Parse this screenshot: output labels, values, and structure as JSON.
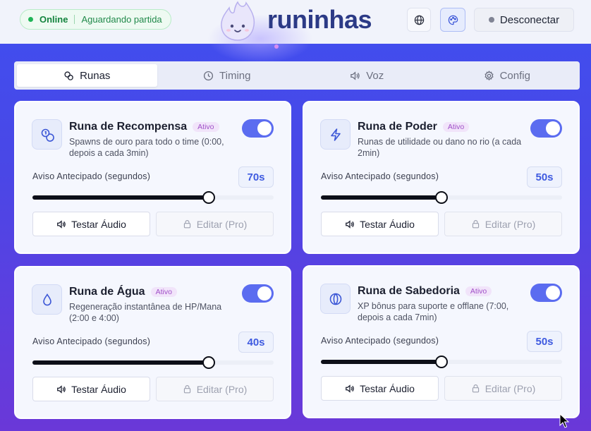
{
  "header": {
    "status_online": "Online",
    "status_sub": "Aguardando partida",
    "logo_text": "runinhas",
    "disconnect_label": "Desconectar"
  },
  "tabs": [
    {
      "label": "Runas",
      "icon": "runes-icon",
      "active": true
    },
    {
      "label": "Timing",
      "icon": "clock-icon",
      "active": false
    },
    {
      "label": "Voz",
      "icon": "speaker-icon",
      "active": false
    },
    {
      "label": "Config",
      "icon": "gear-icon",
      "active": false
    }
  ],
  "cards": [
    {
      "title": "Runa de Recompensa",
      "badge": "Ativo",
      "description": "Spawns de ouro para todo o time (0:00, depois a cada 3min)",
      "icon": "bounty-coins-icon",
      "enabled": true,
      "warn_label": "Aviso Antecipado (segundos)",
      "warn_value": "70s",
      "slider_fraction": 0.73,
      "test_label": "Testar Áudio",
      "edit_label": "Editar (Pro)"
    },
    {
      "title": "Runa de Poder",
      "badge": "Ativo",
      "description": "Runas de utilidade ou dano no rio (a cada 2min)",
      "icon": "lightning-icon",
      "enabled": true,
      "warn_label": "Aviso Antecipado (segundos)",
      "warn_value": "50s",
      "slider_fraction": 0.5,
      "test_label": "Testar Áudio",
      "edit_label": "Editar (Pro)"
    },
    {
      "title": "Runa de Água",
      "badge": "Ativo",
      "description": "Regeneração instantânea de HP/Mana (2:00 e 4:00)",
      "icon": "water-drop-icon",
      "enabled": true,
      "warn_label": "Aviso Antecipado (segundos)",
      "warn_value": "40s",
      "slider_fraction": 0.73,
      "test_label": "Testar Áudio",
      "edit_label": "Editar (Pro)"
    },
    {
      "title": "Runa de Sabedoria",
      "badge": "Ativo",
      "description": "XP bônus para suporte e offlane (7:00, depois a cada 7min)",
      "icon": "wisdom-rune-icon",
      "enabled": true,
      "warn_label": "Aviso Antecipado (segundos)",
      "warn_value": "50s",
      "slider_fraction": 0.5,
      "test_label": "Testar Áudio",
      "edit_label": "Editar (Pro)"
    }
  ],
  "colors": {
    "accent": "#5b6cf0",
    "status_green": "#1fb457",
    "value_blue": "#3e5ae0",
    "badge_purple": "#a050c8"
  }
}
